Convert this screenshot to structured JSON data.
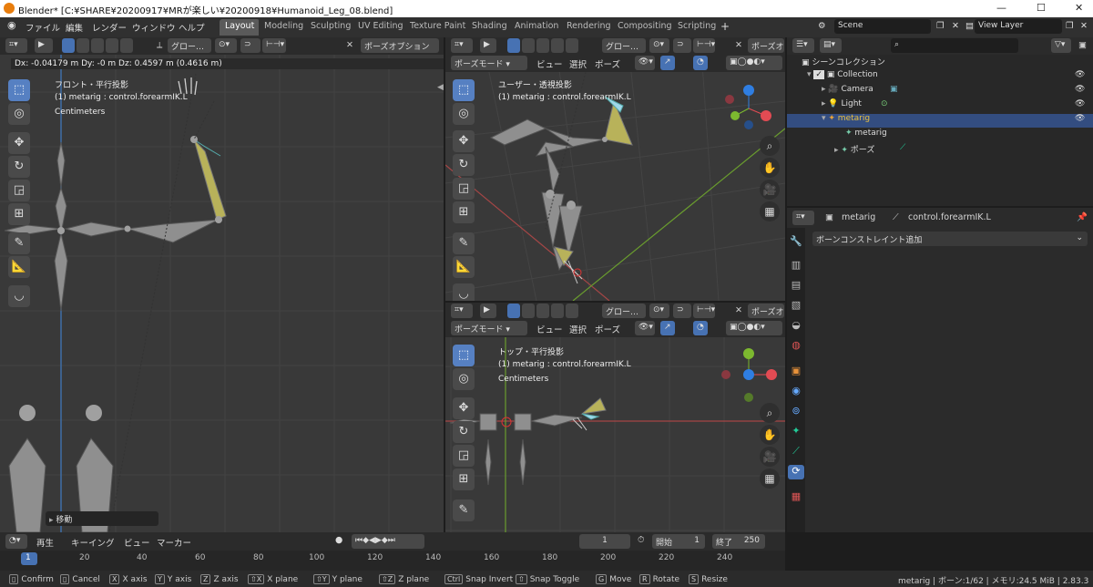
{
  "titlebar": {
    "title": "Blender* [C:¥SHARE¥20200917¥MRが楽しい¥20200918¥Humanoid_Leg_08.blend]"
  },
  "menus": [
    "ファイル",
    "編集",
    "レンダー",
    "ウィンドウ",
    "ヘルプ"
  ],
  "workspaces": [
    "Layout",
    "Modeling",
    "Sculpting",
    "UV Editing",
    "Texture Paint",
    "Shading",
    "Animation",
    "Rendering",
    "Compositing",
    "Scripting"
  ],
  "scene": {
    "scene_name": "Scene",
    "view_layer": "View Layer"
  },
  "vp_left": {
    "transform_text": "Dx: -0.04179 m  Dy: -0 m  Dz: 0.4597 m (0.4616 m)",
    "orient": "グロー…",
    "pose_options": "ポーズオプション",
    "view_name": "フロント・平行投影",
    "object_info": "(1) metarig : control.forearmIK.L",
    "units": "Centimeters",
    "last_op": "移動"
  },
  "vp_persp": {
    "mode": "ポーズモード",
    "menu": [
      "ビュー",
      "選択",
      "ポーズ"
    ],
    "orient": "グロー…",
    "pose_opt": "ポーズオ",
    "view_name": "ユーザー・透視投影",
    "object_info": "(1) metarig : control.forearmIK.L"
  },
  "vp_top": {
    "mode": "ポーズモード",
    "menu": [
      "ビュー",
      "選択",
      "ポーズ"
    ],
    "orient": "グロー…",
    "pose_opt": "ポーズオ",
    "view_name": "トップ・平行投影",
    "object_info": "(1) metarig : control.forearmIK.L",
    "units": "Centimeters"
  },
  "outliner": {
    "root": "シーンコレクション",
    "rows": [
      {
        "label": "Collection"
      },
      {
        "label": "Camera"
      },
      {
        "label": "Light"
      },
      {
        "label": "metarig"
      },
      {
        "label": "metarig"
      },
      {
        "label": "ポーズ"
      }
    ]
  },
  "properties": {
    "object": "metarig",
    "bone": "control.forearmIK.L",
    "add_constraint": "ボーンコンストレイント追加"
  },
  "timeline": {
    "menus": [
      "再生",
      "キーイング",
      "ビュー",
      "マーカー"
    ],
    "current_frame": "1",
    "start_label": "開始",
    "start": "1",
    "end_label": "終了",
    "end": "250",
    "ticks": [
      "1",
      "20",
      "40",
      "60",
      "80",
      "100",
      "120",
      "140",
      "160",
      "180",
      "200",
      "220",
      "240"
    ]
  },
  "statusbar": {
    "items": [
      {
        "key": "",
        "label": "Confirm"
      },
      {
        "key": "",
        "label": "Cancel"
      },
      {
        "key": "X",
        "label": "X axis"
      },
      {
        "key": "Y",
        "label": "Y axis"
      },
      {
        "key": "Z",
        "label": "Z axis"
      },
      {
        "key": "⇧X",
        "label": "X plane"
      },
      {
        "key": "⇧Y",
        "label": "Y plane"
      },
      {
        "key": "⇧Z",
        "label": "Z plane"
      },
      {
        "key": "Ctrl",
        "label": "Snap Invert"
      },
      {
        "key": "⇧",
        "label": "Snap Toggle"
      },
      {
        "key": "G",
        "label": "Move"
      },
      {
        "key": "R",
        "label": "Rotate"
      },
      {
        "key": "S",
        "label": "Resize"
      }
    ],
    "info": "metarig | ボーン:1/62 | メモリ:24.5 MiB | 2.83.3"
  },
  "colors": {
    "accent": "#4772b3",
    "bone_selected": "#b8b25a",
    "axis_red": "#e24b53",
    "axis_green": "#7cb82f",
    "axis_blue": "#2f7ee2"
  }
}
